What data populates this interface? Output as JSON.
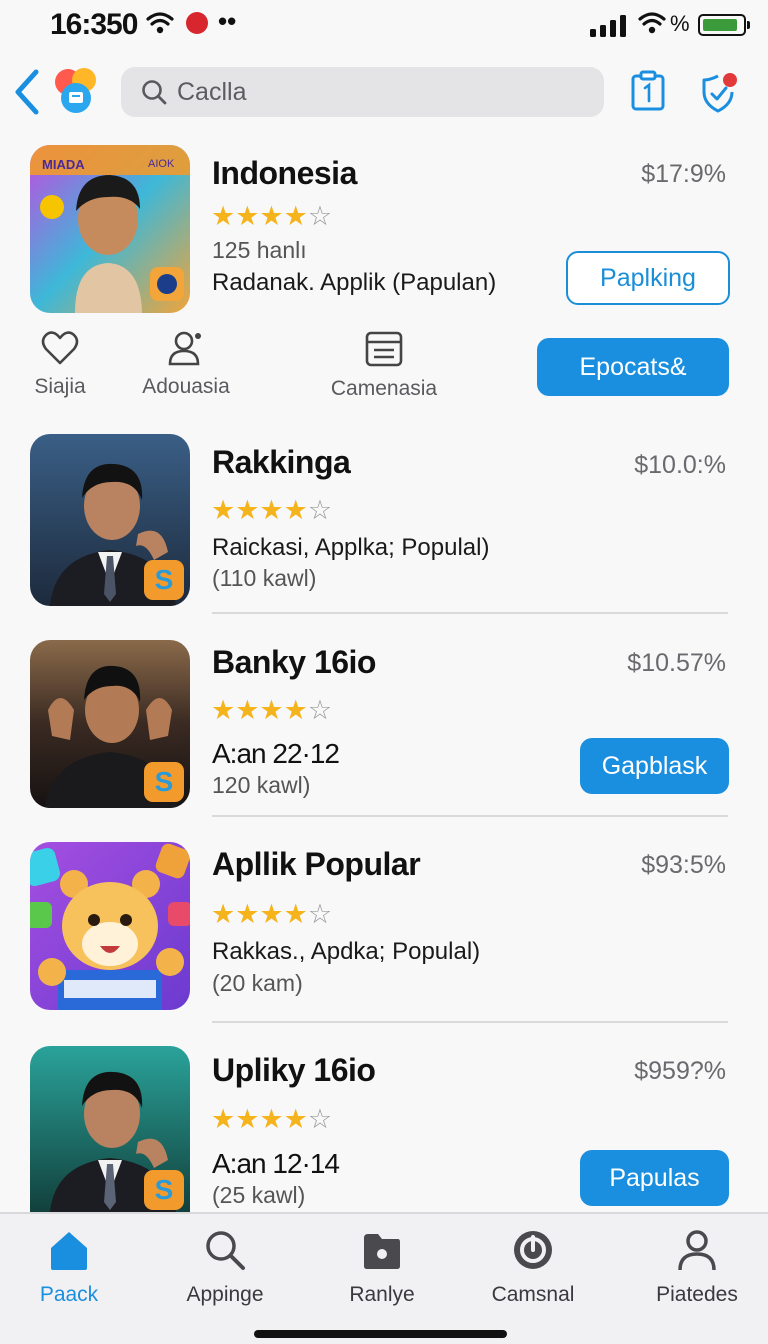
{
  "status_bar": {
    "time": "16:350",
    "battery_pct_symbol": "%"
  },
  "search": {
    "placeholder": "Caclla"
  },
  "featured_actions": [
    {
      "label": "Siajia",
      "icon": "heart-icon"
    },
    {
      "label": "Adouasia",
      "icon": "profile-icon"
    },
    {
      "label": "Camenasia",
      "icon": "list-icon"
    }
  ],
  "featured_action_button": "Epocats&",
  "apps": [
    {
      "name": "Indonesia",
      "price": "$17:9%",
      "rating": 4,
      "line1": "125 hanlı",
      "line2": "Radanak. Applik (Papulan)",
      "button": "Paplking",
      "thumb_tag": "MIADA",
      "thumb_tag2": "AIOK"
    },
    {
      "name": "Rakkinga",
      "price": "$10.0:%",
      "rating": 4,
      "line1": "Raickasi, Applka; Populal)",
      "line2": "(110 kawl)"
    },
    {
      "name": "Banky 16io",
      "price": "$10.57%",
      "rating": 4,
      "line1": "A:an 22·12",
      "line2": "120 kawl)",
      "button": "Gapblask"
    },
    {
      "name": "Apllik Popular",
      "price": "$93:5%",
      "rating": 4,
      "line1": "Rakkas., Apdka; Populal)",
      "line2": "(20 kam)"
    },
    {
      "name": "Upliky 16io",
      "price": "$959?%",
      "rating": 4,
      "line1": "A:an 12·14",
      "line2": "(25 kawl)",
      "button": "Papulas"
    }
  ],
  "tabs": [
    {
      "label": "Paack",
      "icon": "home-icon",
      "active": true
    },
    {
      "label": "Appinge",
      "icon": "search-icon",
      "active": false
    },
    {
      "label": "Ranlye",
      "icon": "folder-icon",
      "active": false
    },
    {
      "label": "Camsnal",
      "icon": "power-icon",
      "active": false
    },
    {
      "label": "Piatedes",
      "icon": "person-icon",
      "active": false
    }
  ],
  "colors": {
    "accent": "#1a8fe0",
    "star": "#f5b31c",
    "text": "#111111"
  }
}
